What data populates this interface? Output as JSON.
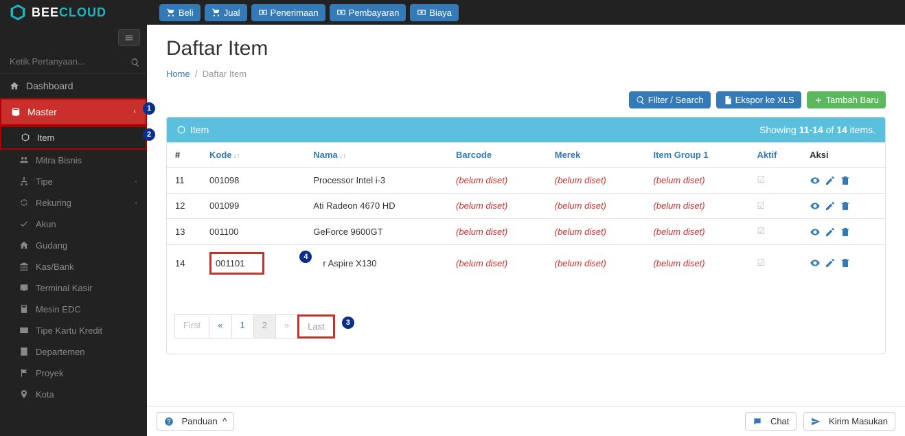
{
  "logo": {
    "brand1": "BEE",
    "brand2": "CLOUD"
  },
  "topButtons": [
    {
      "icon": "cart",
      "label": "Beli"
    },
    {
      "icon": "cart",
      "label": "Jual"
    },
    {
      "icon": "money",
      "label": "Penerimaan"
    },
    {
      "icon": "money",
      "label": "Pembayaran"
    },
    {
      "icon": "money",
      "label": "Biaya"
    }
  ],
  "sidebar": {
    "searchPlaceholder": "Ketik Pertanyaan...",
    "dashboard": "Dashboard",
    "master": "Master",
    "items": [
      {
        "icon": "cube",
        "label": "Item"
      },
      {
        "icon": "users",
        "label": "Mitra Bisnis"
      },
      {
        "icon": "sitemap",
        "label": "Tipe",
        "chev": true
      },
      {
        "icon": "refresh",
        "label": "Rekuring",
        "chev": true
      },
      {
        "icon": "check",
        "label": "Akun"
      },
      {
        "icon": "home",
        "label": "Gudang"
      },
      {
        "icon": "bank",
        "label": "Kas/Bank"
      },
      {
        "icon": "desktop",
        "label": "Terminal Kasir"
      },
      {
        "icon": "calculator",
        "label": "Mesin EDC"
      },
      {
        "icon": "creditcard",
        "label": "Tipe Kartu Kredit"
      },
      {
        "icon": "building",
        "label": "Departemen"
      },
      {
        "icon": "flag",
        "label": "Proyek"
      },
      {
        "icon": "marker",
        "label": "Kota"
      }
    ]
  },
  "page": {
    "title": "Daftar Item",
    "breadcrumbHome": "Home",
    "breadcrumbCurrent": "Daftar Item"
  },
  "actions": {
    "filter": "Filter / Search",
    "export": "Ekspor ke XLS",
    "add": "Tambah Baru"
  },
  "panel": {
    "title": "Item",
    "summaryPrefix": "Showing ",
    "summaryRange": "11-14",
    "summaryOf": " of ",
    "summaryTotal": "14",
    "summarySuffix": " items."
  },
  "columns": {
    "num": "#",
    "kode": "Kode",
    "nama": "Nama",
    "barcode": "Barcode",
    "merek": "Merek",
    "group": "Item Group 1",
    "aktif": "Aktif",
    "aksi": "Aksi"
  },
  "unsetText": "(belum diset)",
  "rows": [
    {
      "n": "11",
      "kode": "001098",
      "nama": "Processor Intel i-3"
    },
    {
      "n": "12",
      "kode": "001099",
      "nama": "Ati Radeon 4670 HD"
    },
    {
      "n": "13",
      "kode": "001100",
      "nama": "GeForce 9600GT"
    },
    {
      "n": "14",
      "kode": "001101",
      "nama": "r Aspire X130",
      "highlightCode": true,
      "nameMarker": true
    }
  ],
  "pager": {
    "first": "First",
    "prev": "«",
    "p1": "1",
    "p2": "2",
    "next": "»",
    "last": "Last"
  },
  "footer": {
    "panduan": "Panduan",
    "chat": "Chat",
    "kirim": "Kirim Masukan"
  },
  "markers": {
    "m1": "1",
    "m2": "2",
    "m3": "3",
    "m4": "4"
  }
}
